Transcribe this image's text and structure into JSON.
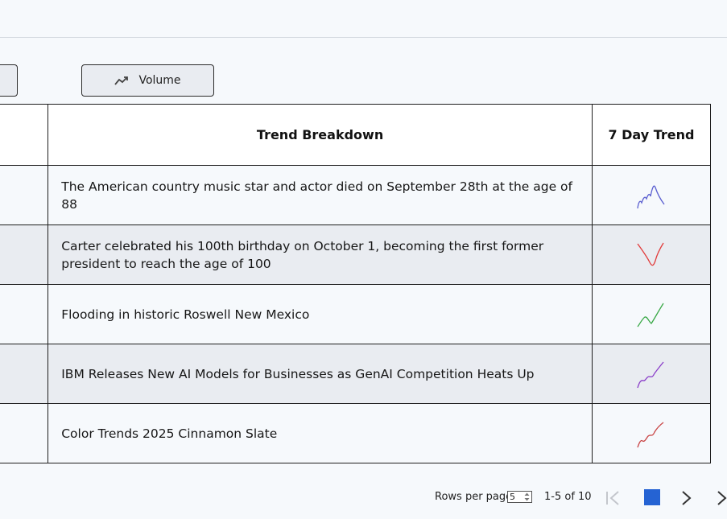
{
  "buttons": {
    "volume_label": "Volume",
    "volume_icon": "trending-up-icon"
  },
  "table": {
    "headers": {
      "breakdown": "Trend Breakdown",
      "trend": "7 Day Trend"
    },
    "rows": [
      {
        "breakdown": "The American country music star and actor died on September 28th at the age of 88",
        "trend_color": "#5a5fd0",
        "trend_icon": "sparkline-icon"
      },
      {
        "breakdown": "Carter celebrated his 100th birthday on October 1, becoming the first former president to reach the age of 100",
        "trend_color": "#e23b3b",
        "trend_icon": "sparkline-icon"
      },
      {
        "breakdown": "Flooding in historic Roswell New Mexico",
        "trend_color": "#38a845",
        "trend_icon": "sparkline-icon"
      },
      {
        "breakdown": "IBM Releases New AI Models for Businesses as GenAI Competition Heats Up",
        "trend_color": "#8a3dc9",
        "trend_icon": "sparkline-icon"
      },
      {
        "breakdown": "Color Trends 2025 Cinnamon Slate",
        "trend_color": "#c94545",
        "trend_icon": "sparkline-icon"
      }
    ]
  },
  "pagination": {
    "rows_per_page_label": "Rows per page",
    "rows_per_page_value": "5",
    "range_text": "1-5 of 10",
    "accent_color": "#2563d3"
  }
}
